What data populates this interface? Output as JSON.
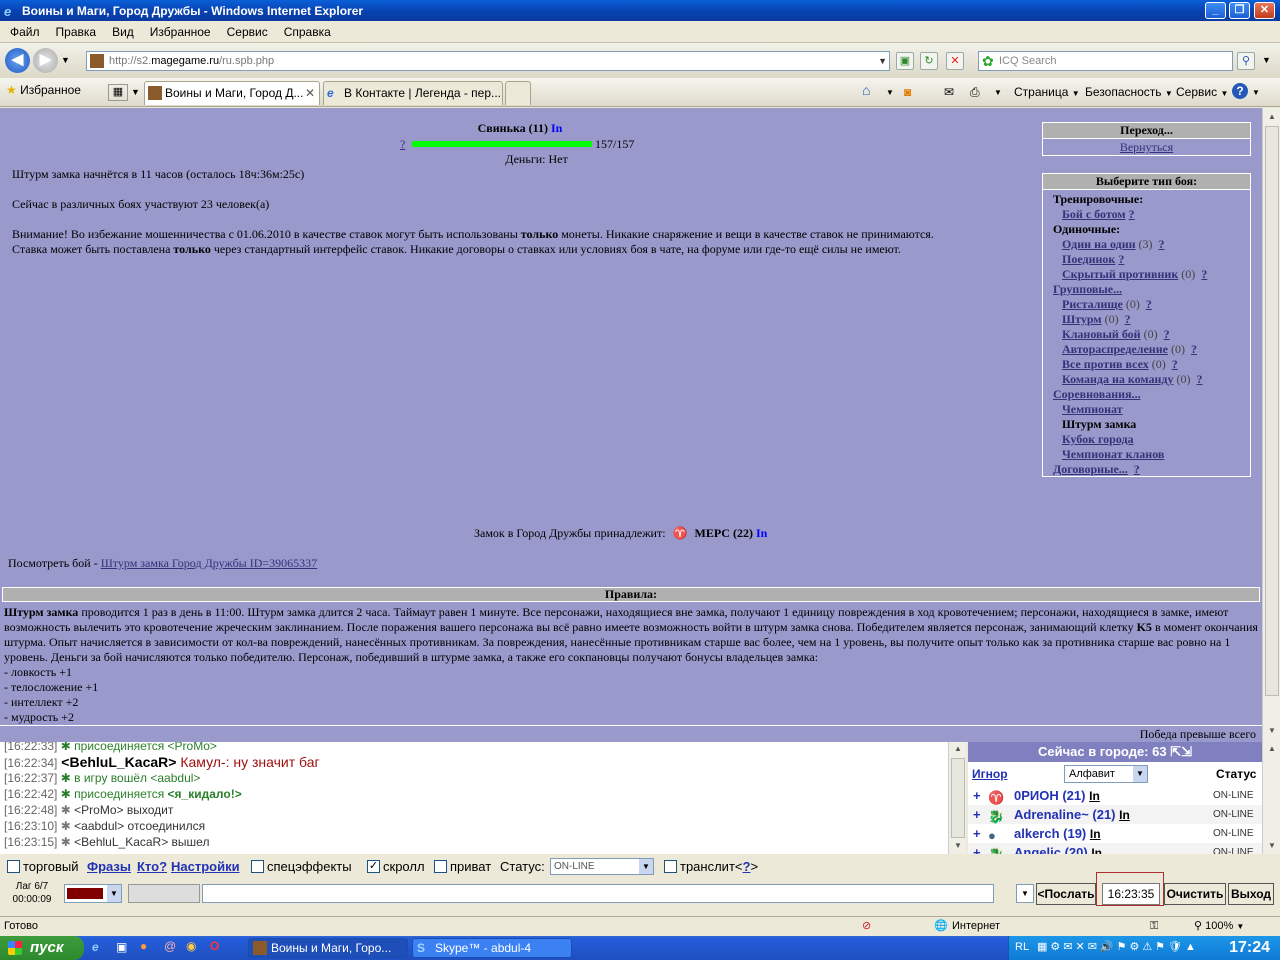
{
  "window": {
    "title": "Воины и Маги, Город Дружбы - Windows Internet Explorer"
  },
  "menu": [
    "Файл",
    "Правка",
    "Вид",
    "Избранное",
    "Сервис",
    "Справка"
  ],
  "address": {
    "prefix": "http://s2.",
    "domain": "magegame.ru",
    "path": "/ru.spb.php"
  },
  "search": {
    "placeholder": "ICQ Search"
  },
  "favorites_label": "Избранное",
  "tabs": [
    {
      "label": "Воины и Маги, Город Д..."
    },
    {
      "label": "В Контакте | Легенда - пер..."
    }
  ],
  "command_bar": {
    "page": "Страница",
    "safety": "Безопасность",
    "tools": "Сервис"
  },
  "player": {
    "name": "Свинька (11)",
    "in": "In",
    "hp_q": "?",
    "hp": "157/157",
    "money": "Деньги: Нет",
    "hp_fraction": 1.0
  },
  "info": {
    "siege": "Штурм замка начнётся в 11 часов (осталось 18ч:36м:25с)",
    "fighters": "Сейчас в различных боях участвуют 23 человек(а)",
    "warn1a": "Внимание! Во избежание мошенничества с 01.06.2010 в качестве ставок могут быть использованы ",
    "warn1b": "только",
    "warn1c": " монеты. Никакие снаряжение и вещи в качестве ставок не принимаются.",
    "warn2a": "Ставка может быть поставлена ",
    "warn2b": "только",
    "warn2c": " через стандартный интерфейс ставок. Никакие договоры о ставках или условиях боя в чате, на форуме или где-то ещё силы не имеют.",
    "castle_owner": "Замок в Город Дружбы принадлежит:",
    "owner_name": "МЕРС (22)",
    "owner_in": "In",
    "view_fight": "Посмотреть бой - ",
    "view_fight_link": "Штурм замка Город Дружбы ID=39065337"
  },
  "goto_panel": {
    "title": "Переход...",
    "back": "Вернуться"
  },
  "fight_panel": {
    "title": "Выберите тип боя:",
    "training": "Тренировочные:",
    "bot": "Бой с ботом",
    "single": "Одиночные:",
    "one_on_one": "Один на один",
    "one_on_one_count": "(3)",
    "duels": "Поединок",
    "hidden": "Скрытый противник",
    "hidden_count": "(0)",
    "group": "Групповые...",
    "arena": "Ристалище",
    "arena_count": "(0)",
    "storm": "Штурм",
    "storm_count": "(0)",
    "clan": "Клановый бой",
    "clan_count": "(0)",
    "auto": "Автораспределение",
    "auto_count": "(0)",
    "all": "Все против всех",
    "all_count": "(0)",
    "team": "Команда на команду",
    "team_count": "(0)",
    "comp": "Соревнования...",
    "champ": "Чемпионат",
    "siege": "Штурм замка",
    "cup": "Кубок города",
    "clan_champ": "Чемпионат кланов",
    "contract": "Договорные...",
    "q": "?"
  },
  "rules": {
    "title": "Правила:",
    "bold": "Штурм замка",
    "text1": " проводится 1 раз в день в 11:00. Штурм замка длится 2 часа. Таймаут равен 1 минуте. Все персонажи, находящиеся вне замка, получают 1 единицу повреждения в ход кровотечением; персонажи, находящиеся в замке, имеют возможность вылечить это кровотечение жреческим заклинанием. После поражения вашего персонажа вы всё равно имеете возможность войти в штурм замка снова. Победителем является персонаж, занимающий клетку ",
    "cell": "K5",
    "text2": " в момент окончания штурма. Опыт начисляется в зависимости от кол-ва повреждений, нанесённых противникам. За повреждения, нанесённые противникам старше вас более, чем на 1 уровень, вы получите опыт только как за противника старше вас ровно на 1 уровень. Деньги за бой начисляются только победителю. Персонаж, победивший в штурме замка, а также его сокпановцы получают бонусы владельцев замка:",
    "b1": "- ловкость +1",
    "b2": "- телосложение +1",
    "b3": "- интеллект +2",
    "b4": "- мудрость +2",
    "footer": "Победа превыше всего"
  },
  "chat": [
    {
      "time": "[16:22:33]",
      "pre": "присоединяется ",
      "nick": "<ProMo>",
      "post": "",
      "type": "sys"
    },
    {
      "time": "[16:22:34]",
      "nick": "<BehluL_KacaR>",
      "msg": " Камул-: ну значит баг",
      "type": "msg"
    },
    {
      "time": "[16:22:37]",
      "pre": "в игру вошёл ",
      "nick": "<aabdul>",
      "post": "",
      "type": "sys"
    },
    {
      "time": "[16:22:42]",
      "pre": "присоединяется ",
      "nick": "<я_кидало!>",
      "post": "",
      "type": "sys"
    },
    {
      "time": "[16:22:48]",
      "pre": "",
      "nick": "<ProMo>",
      "post": " выходит",
      "type": "sys2"
    },
    {
      "time": "[16:23:10]",
      "pre": "",
      "nick": "<aabdul>",
      "post": " отсоединился",
      "type": "sys2"
    },
    {
      "time": "[16:23:15]",
      "pre": "",
      "nick": "<BehluL_KacaR>",
      "post": " вышел",
      "type": "sys2"
    }
  ],
  "online": {
    "title": "Сейчас в городе: 63",
    "ignore": "Игнор",
    "sort": "Алфавит",
    "status_col": "Статус",
    "users": [
      {
        "name": "0РИОН (21)",
        "in": "In",
        "status": "ON-LINE"
      },
      {
        "name": "Adrenaline~ (21)",
        "in": "In",
        "status": "ON-LINE"
      },
      {
        "name": "alkerch (19)",
        "in": "In",
        "status": "ON-LINE"
      },
      {
        "name": "Angelic (20)",
        "in": "In",
        "status": "ON-LINE"
      }
    ]
  },
  "controls": {
    "trade": "торговый",
    "phrases": "Фразы",
    "who": "Кто?",
    "settings": "Настройки",
    "effects": "спецэффекты",
    "scroll": "скролл",
    "private": "приват",
    "status_label": "Статус:",
    "status_value": "ON-LINE",
    "translit": "транслит",
    "translit_q": "?",
    "lag": "Лаг 6/7",
    "lag_time": "00:00:09",
    "send": "<Послать",
    "time": "16:23:35",
    "clear": "Очистить",
    "exit": "Выход"
  },
  "statusbar": {
    "ready": "Готово",
    "zone": "Интернет",
    "zoom": "100%"
  },
  "taskbar": {
    "start": "пуск",
    "task1": "Воины и Маги, Горо...",
    "task2": "Skype™ - abdul-4",
    "lang": "RL",
    "clock": "17:24"
  },
  "colors": {
    "content_bg": "#9999cc",
    "accent": "#0a5fd8",
    "hp_bar": "#00ff00"
  }
}
